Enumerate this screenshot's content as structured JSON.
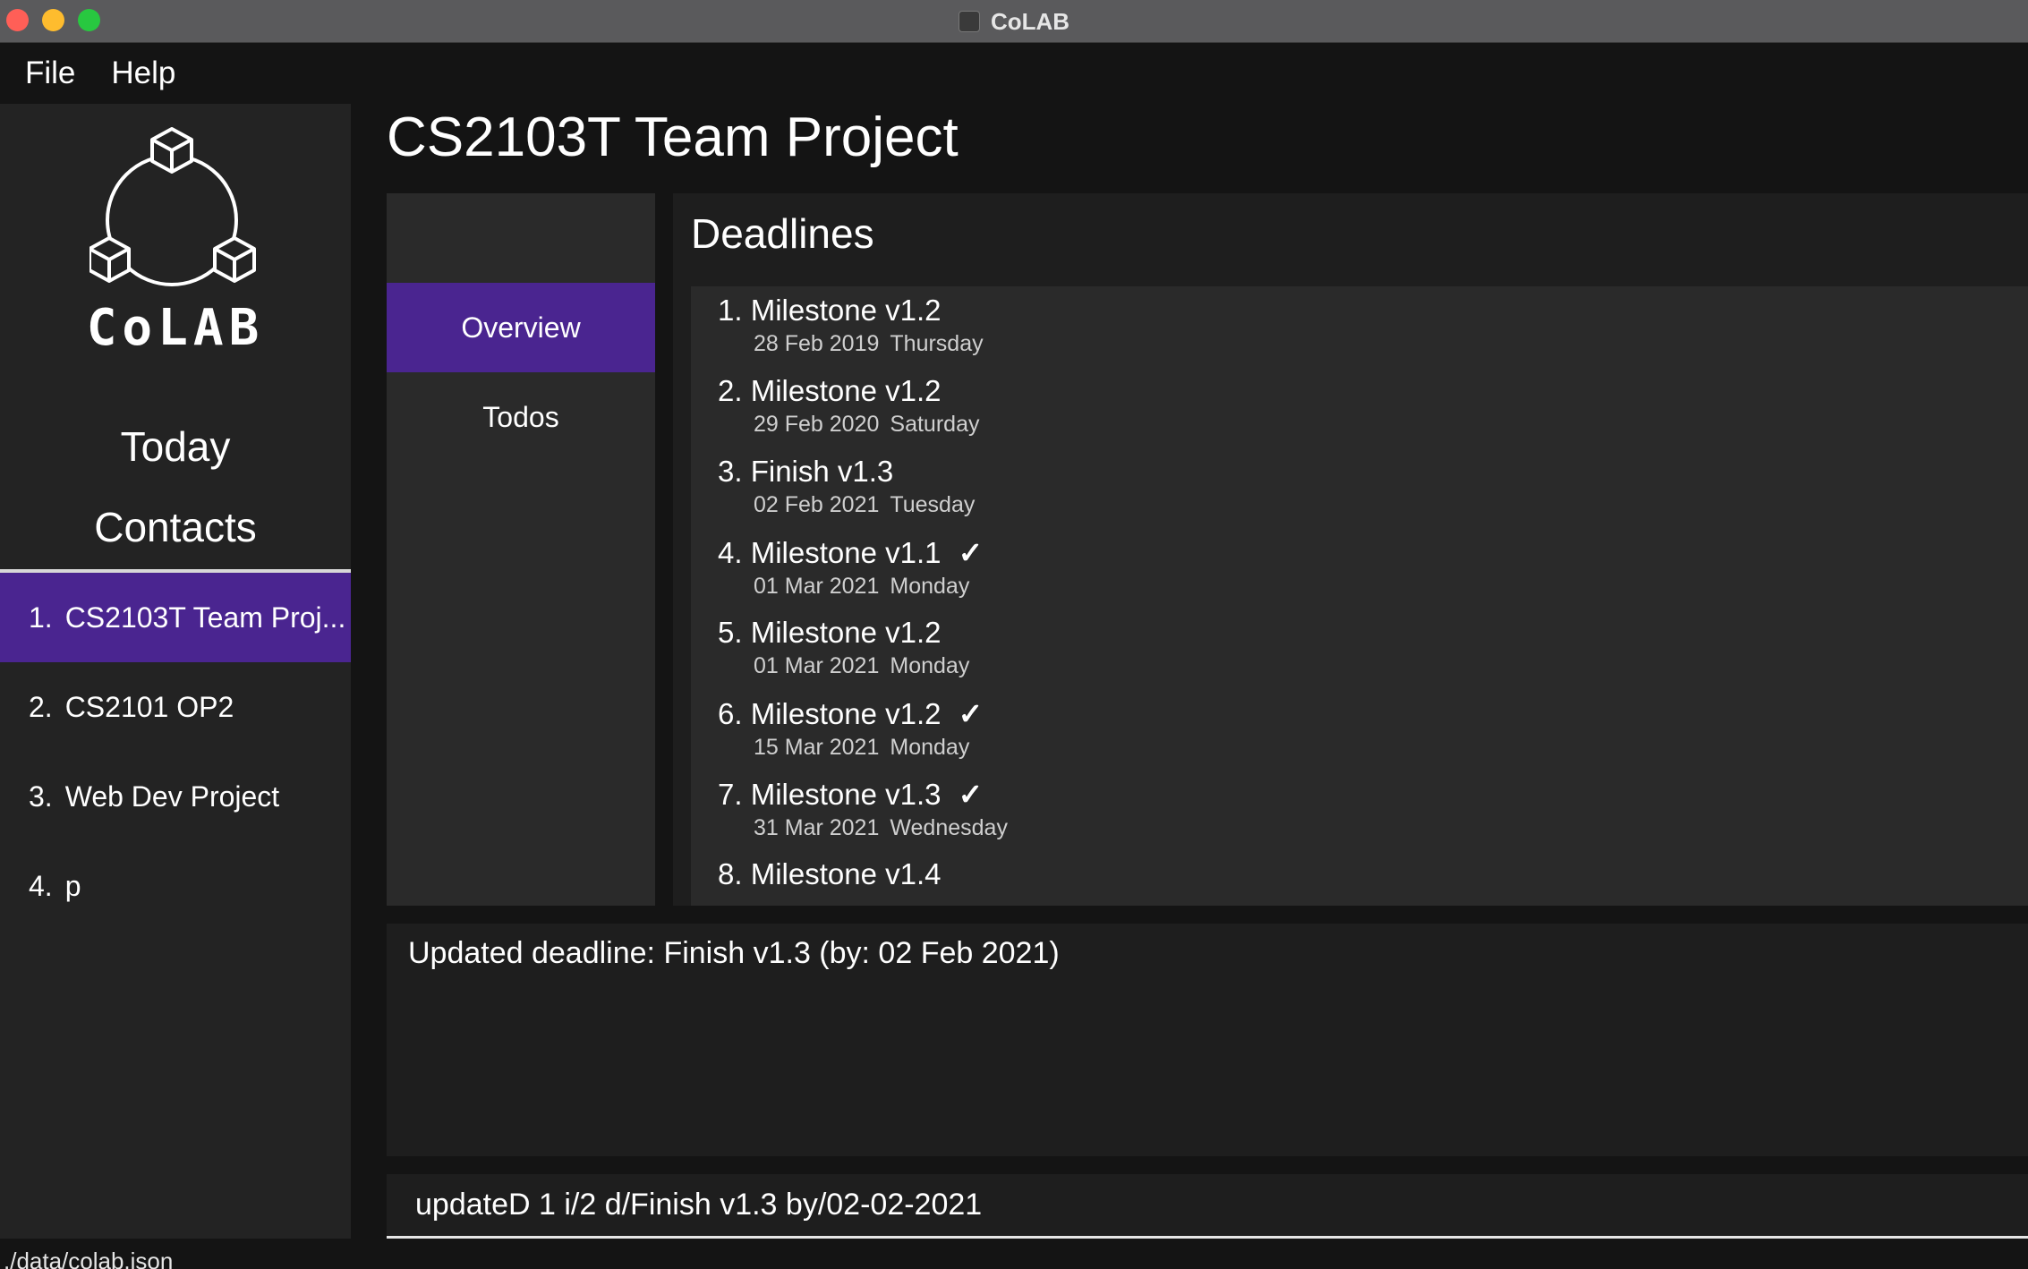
{
  "window": {
    "title": "CoLAB"
  },
  "menu": {
    "file": "File",
    "help": "Help"
  },
  "sidebar": {
    "logo_text": "CoLAB",
    "today": "Today",
    "contacts": "Contacts",
    "projects": [
      {
        "num": "1.",
        "name": "CS2103T Team Proj...",
        "selected": true
      },
      {
        "num": "2.",
        "name": "CS2101 OP2",
        "selected": false
      },
      {
        "num": "3.",
        "name": "Web Dev Project",
        "selected": false
      },
      {
        "num": "4.",
        "name": "p",
        "selected": false
      }
    ]
  },
  "main": {
    "title": "CS2103T Team Project",
    "tabs": [
      {
        "label": "Overview",
        "selected": true
      },
      {
        "label": "Todos",
        "selected": false
      }
    ],
    "deadlines": {
      "header": "Deadlines",
      "items": [
        {
          "num": "1.",
          "title": "Milestone v1.2",
          "date": "28 Feb 2019",
          "day": "Thursday",
          "done": false
        },
        {
          "num": "2.",
          "title": "Milestone v1.2",
          "date": "29 Feb 2020",
          "day": "Saturday",
          "done": false
        },
        {
          "num": "3.",
          "title": "Finish v1.3",
          "date": "02 Feb 2021",
          "day": "Tuesday",
          "done": false
        },
        {
          "num": "4.",
          "title": "Milestone v1.1",
          "date": "01 Mar 2021",
          "day": "Monday",
          "done": true
        },
        {
          "num": "5.",
          "title": "Milestone v1.2",
          "date": "01 Mar 2021",
          "day": "Monday",
          "done": false
        },
        {
          "num": "6.",
          "title": "Milestone v1.2",
          "date": "15 Mar 2021",
          "day": "Monday",
          "done": true
        },
        {
          "num": "7.",
          "title": "Milestone v1.3",
          "date": "31 Mar 2021",
          "day": "Wednesday",
          "done": true
        },
        {
          "num": "8.",
          "title": "Milestone v1.4",
          "date": "",
          "day": "",
          "done": false
        }
      ],
      "check_glyph": "✓"
    },
    "result": "Updated deadline: Finish v1.3 (by: 02 Feb 2021)",
    "command": "updateD 1 i/2 d/Finish v1.3 by/02-02-2021"
  },
  "status": {
    "path": "./data/colab.json"
  },
  "colors": {
    "accent": "#4a2590",
    "background": "#141414",
    "panel": "#2a2a2a"
  }
}
